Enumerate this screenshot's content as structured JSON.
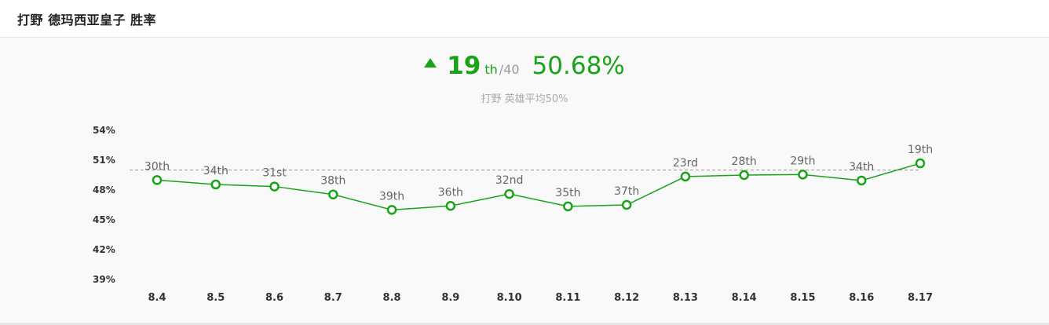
{
  "header": {
    "title": "打野 德玛西亚皇子 胜率"
  },
  "summary": {
    "rank": "19",
    "rank_suffix": "th",
    "rank_total": "/40",
    "win_rate": "50.68%",
    "avg_note": "打野 英雄平均50%",
    "trend": "up"
  },
  "colors": {
    "accent": "#19a319",
    "reference_line": "#999999",
    "label": "#666666"
  },
  "chart_data": {
    "type": "line",
    "categories": [
      "8.4",
      "8.5",
      "8.6",
      "8.7",
      "8.8",
      "8.9",
      "8.10",
      "8.11",
      "8.12",
      "8.13",
      "8.14",
      "8.15",
      "8.16",
      "8.17"
    ],
    "values": [
      49.0,
      48.55,
      48.35,
      47.55,
      46.0,
      46.4,
      47.6,
      46.35,
      46.5,
      49.35,
      49.5,
      49.55,
      48.95,
      50.68
    ],
    "rank_labels": [
      "30th",
      "34th",
      "31st",
      "38th",
      "39th",
      "36th",
      "32nd",
      "35th",
      "37th",
      "23rd",
      "28th",
      "29th",
      "34th",
      "19th"
    ],
    "yticks": [
      "54%",
      "51%",
      "48%",
      "45%",
      "42%",
      "39%"
    ],
    "ylim": [
      39,
      54
    ],
    "reference_line": 50,
    "grid": false
  }
}
